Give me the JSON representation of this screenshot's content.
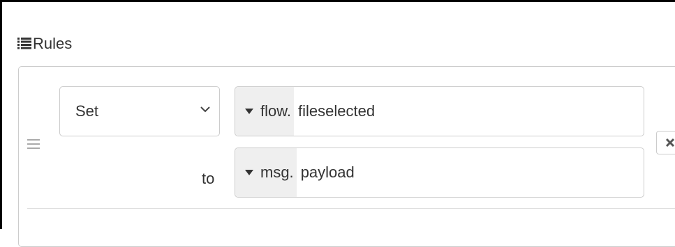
{
  "section": {
    "title": "Rules",
    "icon": "list-icon"
  },
  "rule": {
    "action": {
      "selected": "Set",
      "icon": "chevron-down-icon"
    },
    "to_label": "to",
    "target": {
      "type": "flow.",
      "value": "fileselected"
    },
    "source": {
      "type": "msg.",
      "value": "payload"
    },
    "drag_icon": "drag-handle-icon",
    "delete_icon": "close-icon"
  },
  "colors": {
    "border": "#cccccc",
    "type_bg": "#efefef",
    "text": "#333333"
  }
}
